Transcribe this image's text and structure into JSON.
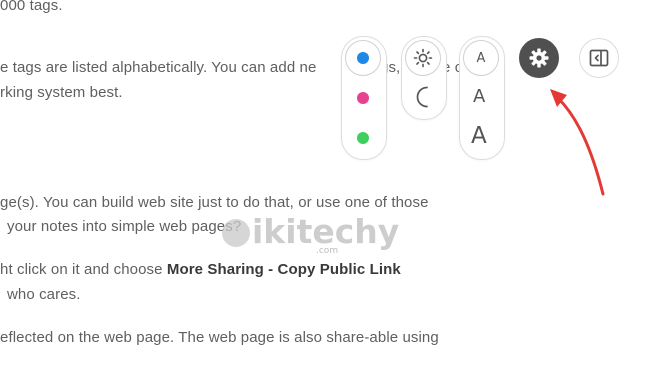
{
  "text_lines": {
    "l1": "000 tags.",
    "l2": "e tags are listed alphabetically. You can add ne",
    "l2b": "gs,",
    "l2c": "e c",
    "l3": "rking system best.",
    "l4": "ge(s). You can build web site just to do that, or use one of those",
    "l5": "your notes into simple web pages?",
    "l6_pre": "ht click on it and choose ",
    "l6_bold": "More Sharing - Copy Public Link",
    "l7": "who cares.",
    "l8": "eflected on the web page. The web page is also share-able using"
  },
  "color_options": [
    {
      "name": "blue",
      "color": "#1e88e5",
      "selected": true
    },
    {
      "name": "pink",
      "color": "#e8418f",
      "selected": false
    },
    {
      "name": "green",
      "color": "#3ecf5f",
      "selected": false
    }
  ],
  "theme_options": [
    "sun-icon",
    "moon-icon"
  ],
  "font_sizes": {
    "small": "A",
    "medium": "A",
    "large": "A"
  },
  "toolbar": {
    "settings_icon": "gear-icon",
    "sidebar_icon": "sidebar-toggle-icon"
  },
  "annotation": {
    "arrow_color": "#e53935"
  },
  "watermark": {
    "logo_letter": "W",
    "text": "ikitechy",
    "sub": ".com"
  }
}
